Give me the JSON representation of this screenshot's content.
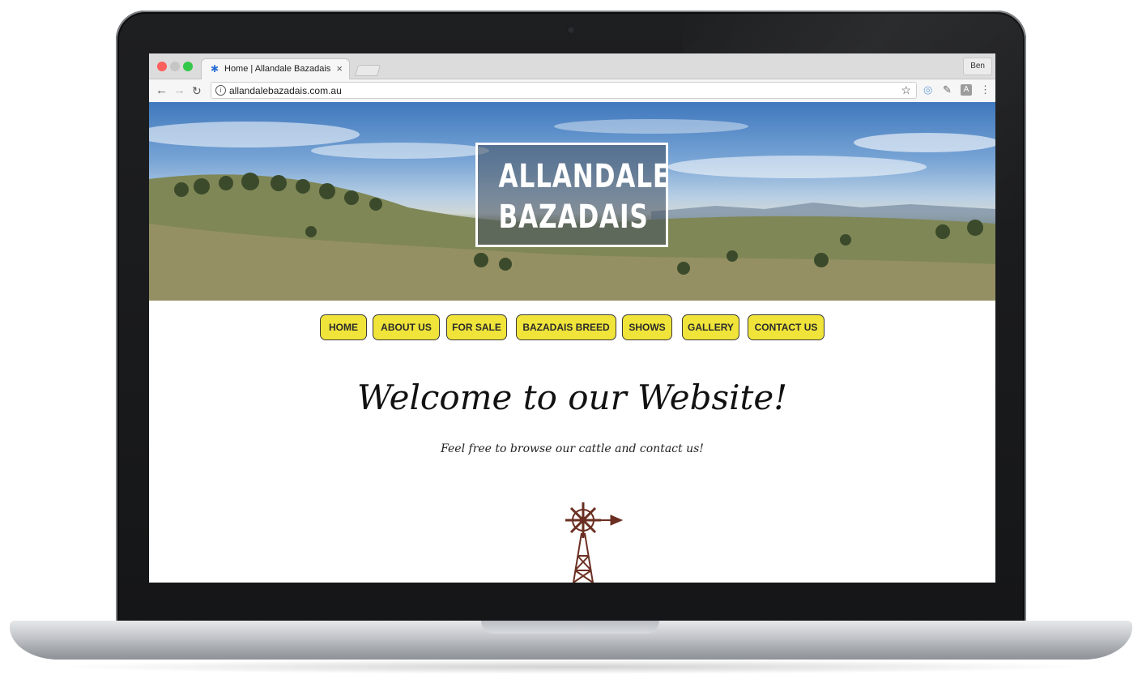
{
  "browser": {
    "tab_title": "Home | Allandale Bazadais",
    "tab_close": "×",
    "url": "allandalebazadais.com.au",
    "profile_name": "Ben",
    "icons": [
      "back-arrow-icon",
      "forward-arrow-icon",
      "reload-icon",
      "info-icon",
      "star-icon",
      "extension-icon",
      "eyedropper-icon",
      "menu-icon"
    ]
  },
  "site": {
    "logo": {
      "line1": "ALLANDALE",
      "line2": "BAZADAIS"
    },
    "nav": [
      {
        "label": "HOME"
      },
      {
        "label": "ABOUT US"
      },
      {
        "label": "FOR SALE"
      },
      {
        "label": "BAZADAIS BREED"
      },
      {
        "label": "SHOWS"
      },
      {
        "label": "GALLERY"
      },
      {
        "label": "CONTACT US"
      }
    ],
    "heading": "Welcome to our Website!",
    "tagline": "Feel free to browse our cattle and contact us!"
  },
  "colors": {
    "nav_button_bg": "#f0e43a",
    "nav_button_border": "#3a3a3a",
    "windmill": "#6a2f22"
  }
}
